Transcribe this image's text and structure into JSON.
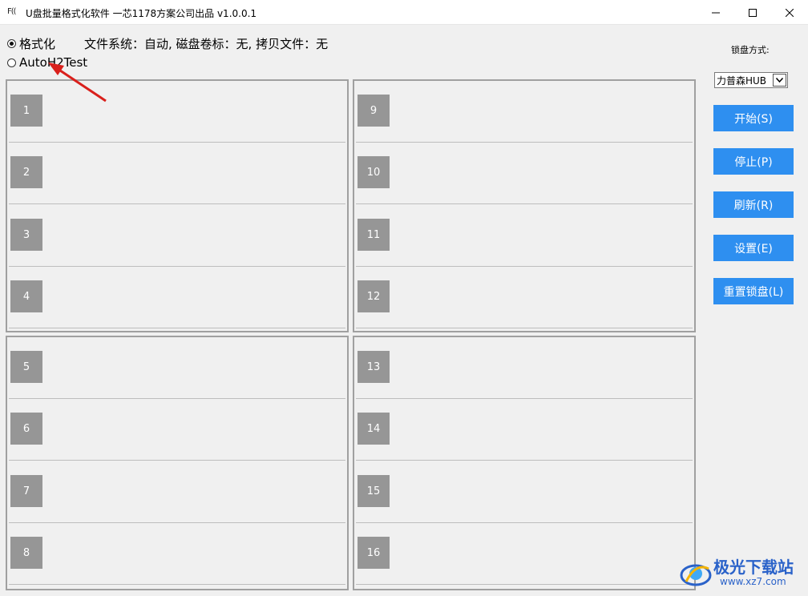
{
  "window": {
    "icon_text": "F((",
    "title": "U盘批量格式化软件  一芯1178方案公司出品 v1.0.0.1"
  },
  "modes": [
    {
      "label": "格式化",
      "selected": true
    },
    {
      "label": "AutoH2Test",
      "selected": false
    }
  ],
  "info_text": "文件系统：自动, 磁盘卷标：无, 拷贝文件：无",
  "slots": [
    "1",
    "2",
    "3",
    "4",
    "5",
    "6",
    "7",
    "8",
    "9",
    "10",
    "11",
    "12",
    "13",
    "14",
    "15",
    "16"
  ],
  "sidebar": {
    "lock_label": "锁盘方式:",
    "lock_value": "力普森HUB",
    "buttons": {
      "start": "开始(S)",
      "stop": "停止(P)",
      "refresh": "刷新(R)",
      "settings": "设置(E)",
      "reset_lock": "重置锁盘(L)"
    }
  },
  "watermark": {
    "name": "极光下载站",
    "url": "www.xz7.com"
  },
  "colors": {
    "button_blue": "#2e8ff0",
    "slot_gray": "#969696",
    "annotation_red": "#d9201c"
  }
}
